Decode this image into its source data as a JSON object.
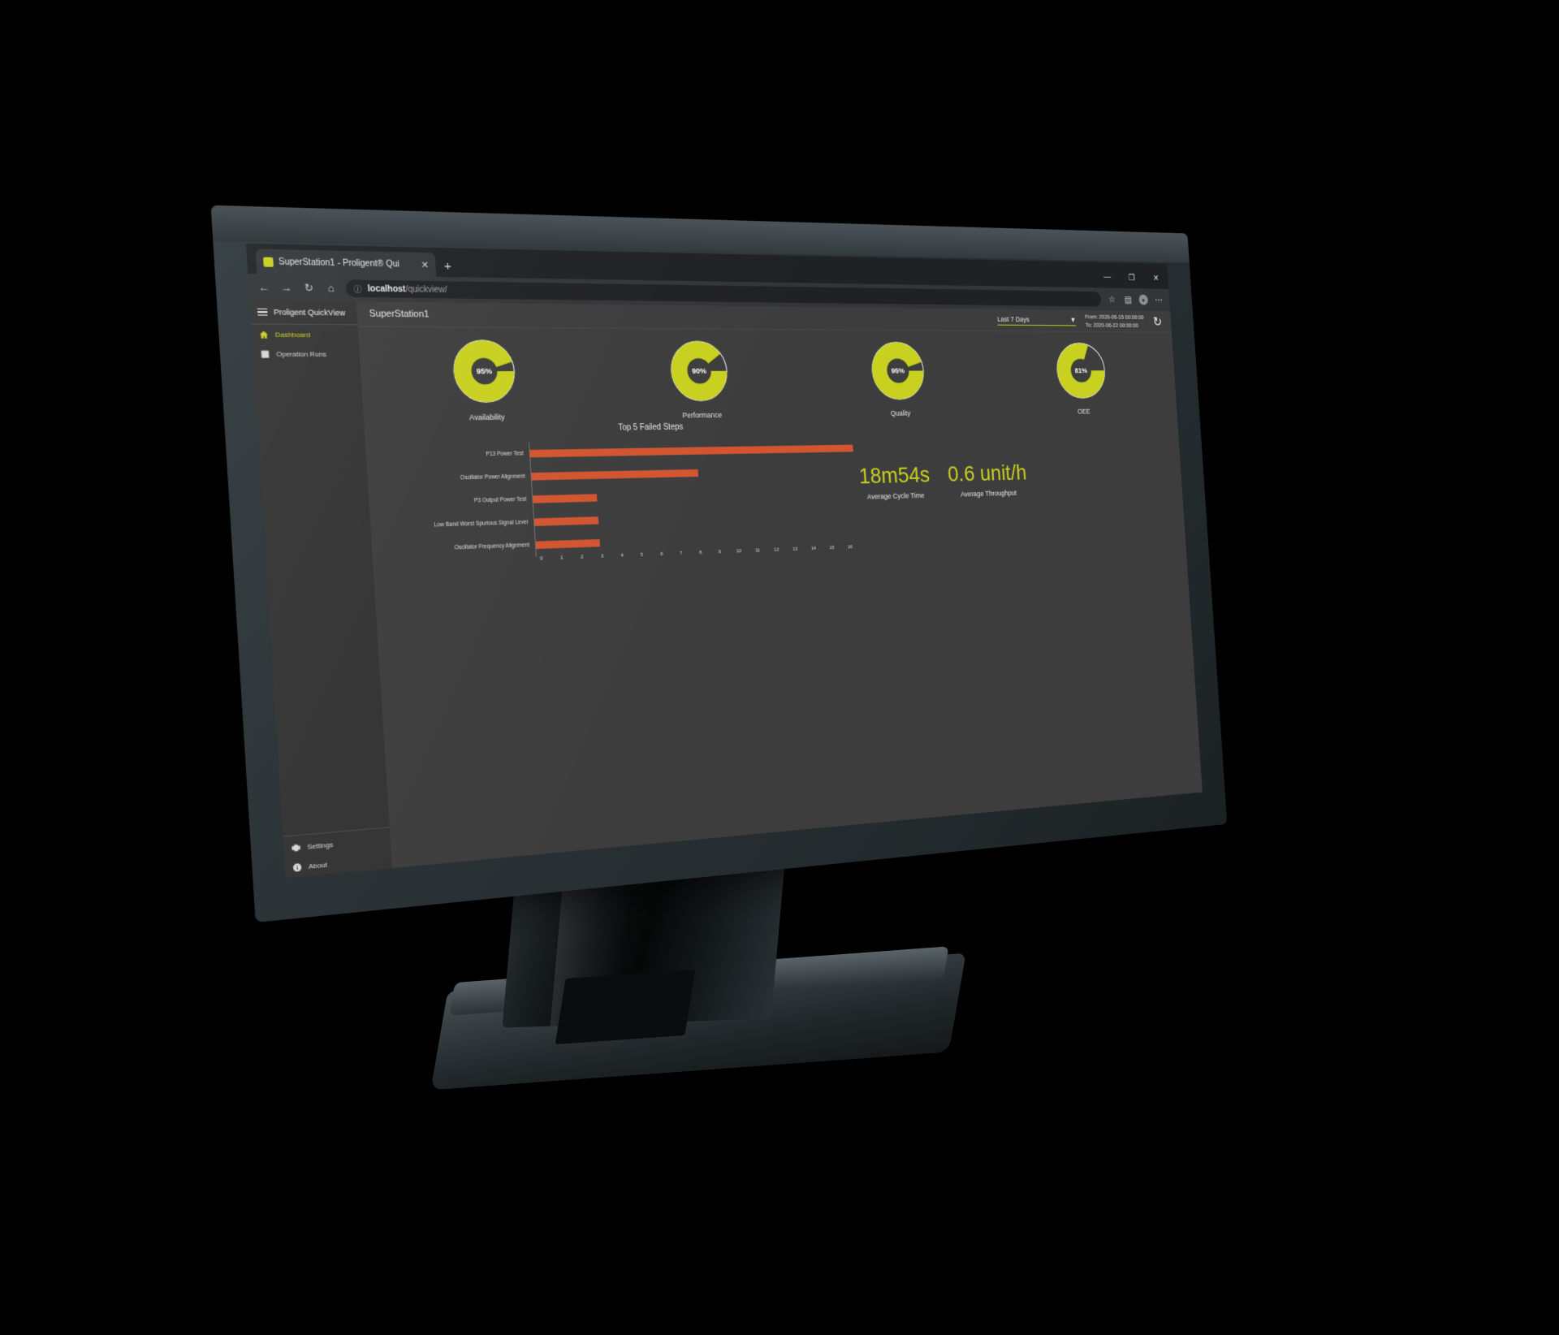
{
  "browser": {
    "tab": {
      "title": "SuperStation1 - Proligent® Qui",
      "close_label": "✕",
      "favicon": "app-favicon"
    },
    "new_tab_label": "+",
    "window_controls": {
      "minimize": "—",
      "maximize": "❐",
      "close": "✕"
    },
    "nav": {
      "back": "←",
      "forward": "→",
      "refresh": "↻",
      "home": "⌂"
    },
    "url": {
      "lock_icon": "ⓘ",
      "host": "localhost",
      "path": "/quickview/"
    },
    "toolbar_right": {
      "favorite": "☆",
      "collections": "▤",
      "profile": "●",
      "more": "⋯"
    }
  },
  "sidebar": {
    "brand_bold": "Proligent",
    "brand_light": " QuickView",
    "items": [
      {
        "label": "Dashboard",
        "icon": "home-icon",
        "active": true
      },
      {
        "label": "Operation Runs",
        "icon": "grid-icon",
        "active": false
      }
    ],
    "bottom_items": [
      {
        "label": "Settings",
        "icon": "gear-icon"
      },
      {
        "label": "About",
        "icon": "info-icon"
      }
    ]
  },
  "header": {
    "station": "SuperStation1",
    "range_select": "Last 7 Days",
    "caret": "▼",
    "from_label": "From: 2020-06-15 00:00:00",
    "to_label": "To: 2020-06-22 00:00:00",
    "refresh_icon": "↻"
  },
  "chart_data": [
    {
      "type": "pie",
      "title": "Availability",
      "categories": [
        "Availability",
        "Remainder"
      ],
      "values": [
        95,
        5
      ],
      "center_label": "95%",
      "colors": {
        "value": "#c8d11f",
        "remainder": "#3d3d3d"
      }
    },
    {
      "type": "pie",
      "title": "Performance",
      "categories": [
        "Performance",
        "Remainder"
      ],
      "values": [
        90,
        10
      ],
      "center_label": "90%",
      "colors": {
        "value": "#c8d11f",
        "remainder": "#3d3d3d"
      }
    },
    {
      "type": "pie",
      "title": "Quality",
      "categories": [
        "Quality",
        "Remainder"
      ],
      "values": [
        95,
        5
      ],
      "center_label": "95%",
      "colors": {
        "value": "#c8d11f",
        "remainder": "#3d3d3d"
      }
    },
    {
      "type": "pie",
      "title": "OEE",
      "categories": [
        "OEE",
        "Remainder"
      ],
      "values": [
        81,
        19
      ],
      "center_label": "81%",
      "colors": {
        "value": "#c8d11f",
        "remainder": "#3d3d3d"
      }
    },
    {
      "type": "bar",
      "orientation": "horizontal",
      "title": "Top 5 Failed Steps",
      "categories": [
        "P13 Power Test",
        "Oscillator Power Alignment",
        "P3 Output Power Test",
        "Low Band Worst Spurious Signal Level",
        "Oscillator Frequency Alignment"
      ],
      "values": [
        16,
        8,
        3,
        3,
        3
      ],
      "xlabel": "",
      "ylabel": "",
      "xlim": [
        0,
        16
      ],
      "xticks": [
        0,
        1,
        2,
        3,
        4,
        5,
        6,
        7,
        8,
        9,
        10,
        11,
        12,
        13,
        14,
        15,
        16
      ],
      "grid": false,
      "bar_color": "#d2552f"
    }
  ],
  "kpis": [
    {
      "value": "18m54s",
      "label": "Average Cycle Time"
    },
    {
      "value": "0.6 unit/h",
      "label": "Average Throughput"
    }
  ]
}
